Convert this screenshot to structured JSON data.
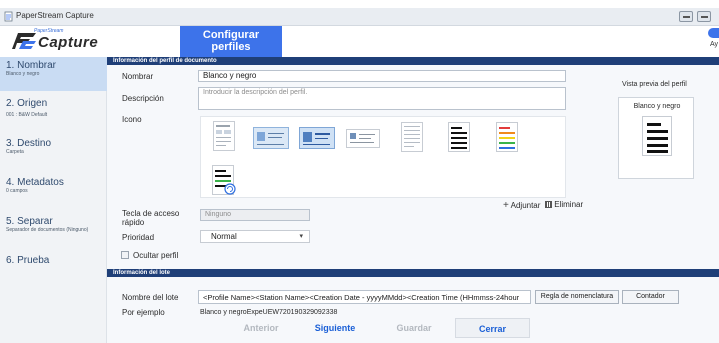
{
  "window": {
    "title": "PaperStream Capture"
  },
  "header": {
    "logo_tagline": "PaperStream",
    "logo_word": "Capture",
    "tab_line1": "Configurar",
    "tab_line2": "perfiles",
    "right_clip": "Ay"
  },
  "sidebar": {
    "steps": [
      {
        "label": "1. Nombrar",
        "sub": "Blanco y negro"
      },
      {
        "label": "2. Origen",
        "sub": "001 : B&W Default"
      },
      {
        "label": "3. Destino",
        "sub": "Carpeta"
      },
      {
        "label": "4. Metadatos",
        "sub": "0 campos"
      },
      {
        "label": "5. Separar",
        "sub": "Separador de documentos (Ninguno)"
      },
      {
        "label": "6. Prueba",
        "sub": ""
      }
    ]
  },
  "profile_section": {
    "title": "Información del perfil de documento",
    "name_label": "Nombrar",
    "name_value": "Blanco y negro",
    "desc_label": "Descripción",
    "desc_placeholder": "Introducir la descripción del perfil.",
    "icon_label": "Icono",
    "add_link": "Adjuntar",
    "delete_link": "Eliminar",
    "hotkey_label_1": "Tecla de acceso",
    "hotkey_label_2": "rápido",
    "hotkey_value": "Ninguno",
    "priority_label": "Prioridad",
    "priority_value": "Normal",
    "hide_label": "Ocultar perfil"
  },
  "preview": {
    "title": "Vista previa del perfil",
    "name": "Blanco y negro"
  },
  "batch_section": {
    "title": "Información del lote",
    "batch_name_label": "Nombre del lote",
    "batch_name_value": "<Profile Name><Station Name><Creation Date - yyyyMMdd><Creation Time (HHmmss-24hour",
    "naming_rule_button": "Regla de nomenclatura",
    "counter_button": "Contador",
    "example_label": "Por ejemplo",
    "example_value": "Blanco y negroExpeUEW720190329092338"
  },
  "footer": {
    "back": "Anterior",
    "next": "Siguiente",
    "save": "Guardar",
    "close": "Cerrar"
  },
  "colors": {
    "accent_blue": "#3d73ea",
    "section_navy": "#1f3f78",
    "sidebar_active": "#c9dcf3",
    "link_blue": "#1a5fd6"
  }
}
